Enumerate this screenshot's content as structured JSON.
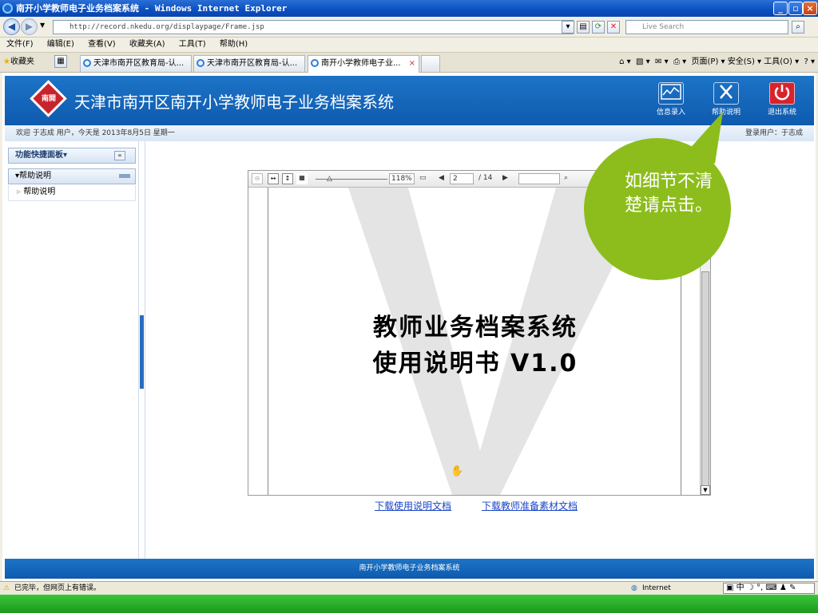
{
  "window": {
    "title": "南开小学教师电子业务档案系统 - Windows Internet Explorer"
  },
  "address": {
    "url": "http://record.nkedu.org/displaypage/Frame.jsp",
    "search_placeholder": "Live Search"
  },
  "menu": [
    "文件(F)",
    "编辑(E)",
    "查看(V)",
    "收藏夹(A)",
    "工具(T)",
    "帮助(H)"
  ],
  "favorites_label": "收藏夹",
  "tabs": [
    "天津市南开区教育局-认...",
    "天津市南开区教育局-认...",
    "南开小学教师电子业..."
  ],
  "command_bar": "页面(P) ▾  安全(S) ▾  工具(O) ▾",
  "header": {
    "logo_text": "南開",
    "system_name": "天津市南开区南开小学教师电子业务档案系统",
    "buttons": [
      {
        "label": "信息录入",
        "icon": "chart-icon"
      },
      {
        "label": "帮助说明",
        "icon": "tools-icon"
      },
      {
        "label": "退出系统",
        "icon": "power-icon"
      }
    ]
  },
  "welcome": {
    "text": "欢迎 于志成 用户，今天是 2013年8月5日 星期一",
    "login_user": "登录用户：于志成"
  },
  "sidebar": {
    "panel_title": "功能快捷面板▾",
    "section_title": "▾帮助说明",
    "items": [
      "帮助说明"
    ]
  },
  "viewer": {
    "zoom": "118%",
    "page_current": "2",
    "page_total": "/ 14",
    "doc_title_line1": "教师业务档案系统",
    "doc_title_line2": "使用说明书 V1.0"
  },
  "links": {
    "download_manual": "下载使用说明文档",
    "download_materials": "下载教师准备素材文档"
  },
  "callout": {
    "text": "如细节不清楚请点击。",
    "color": "#8dbd1c"
  },
  "footer": {
    "text": "南开小学教师电子业务档案系统"
  },
  "status": {
    "text": "已完毕，但网页上有错误。",
    "zone": "Internet",
    "ime": "中"
  }
}
